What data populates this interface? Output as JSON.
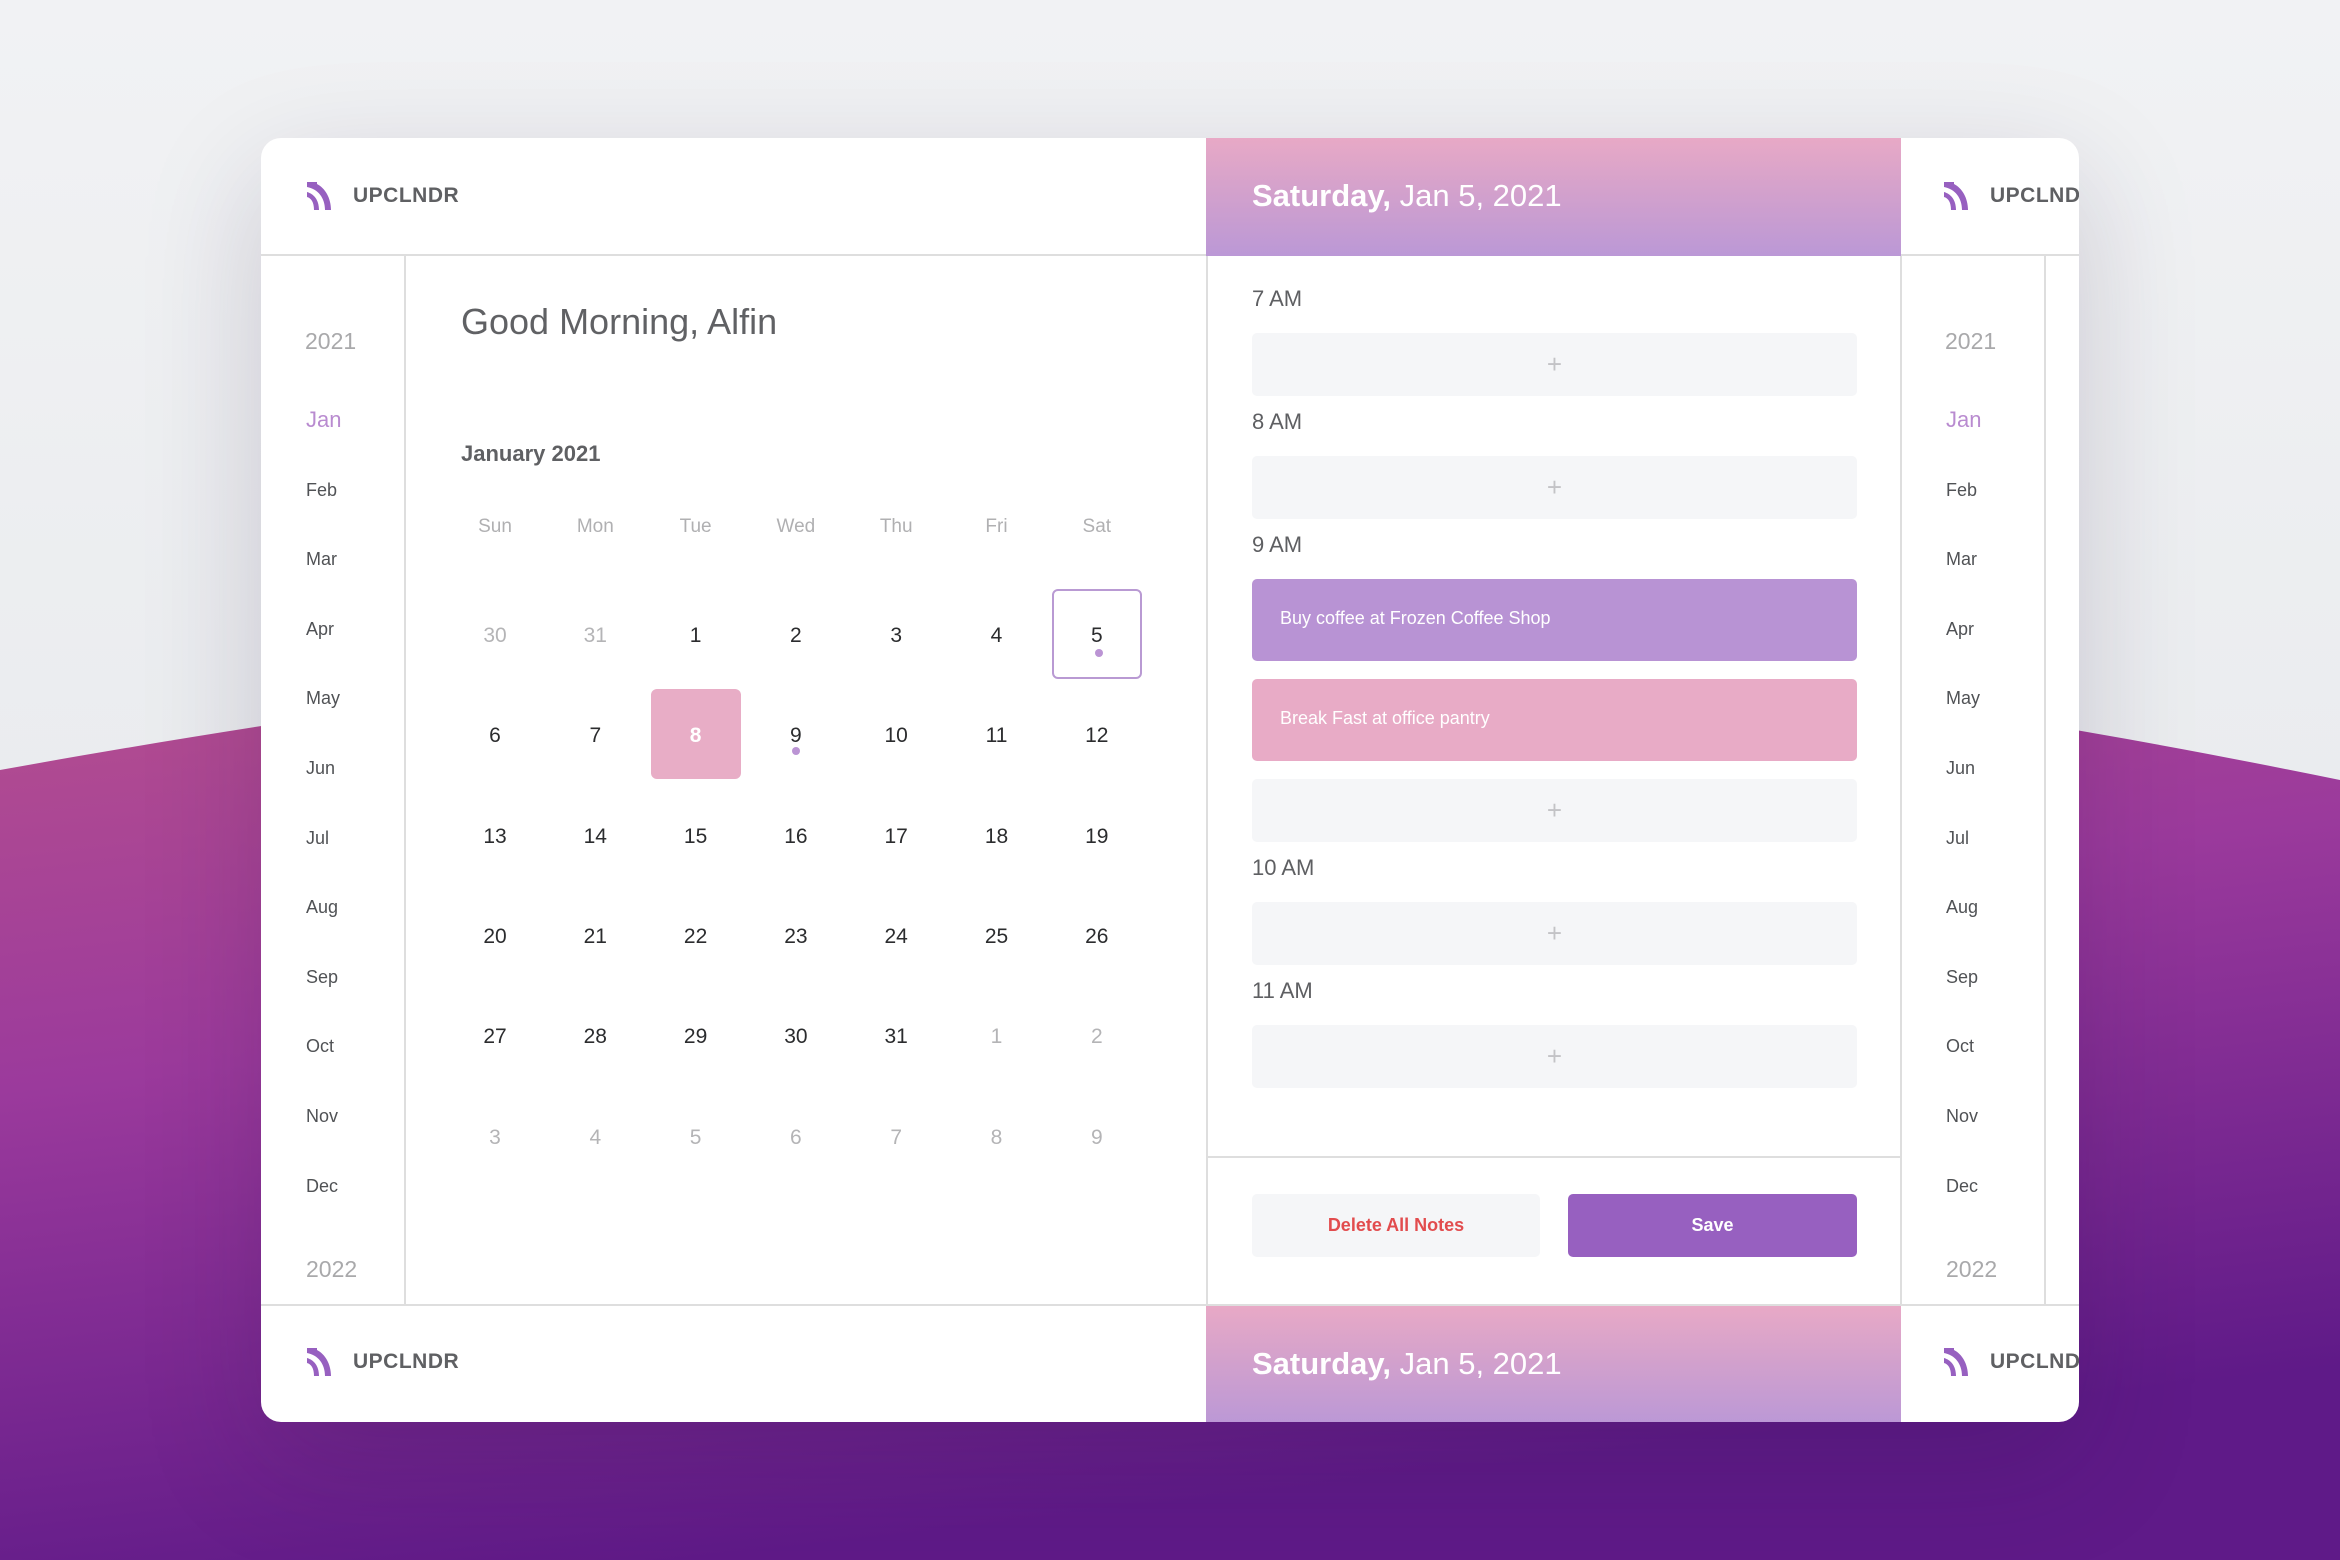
{
  "app": {
    "brand": "UPCLNDR",
    "brand_truncated": "UPCLNDI"
  },
  "header": {
    "weekday": "Saturday,",
    "date": "Jan 5, 2021"
  },
  "sidebar": {
    "year_current": "2021",
    "year_next": "2022",
    "active_month": "Jan",
    "months": [
      "Jan",
      "Feb",
      "Mar",
      "Apr",
      "May",
      "Jun",
      "Jul",
      "Aug",
      "Sep",
      "Oct",
      "Nov",
      "Dec"
    ]
  },
  "main": {
    "greeting": "Good Morning, Alfin",
    "month_title": "January 2021",
    "weekdays": [
      "Sun",
      "Mon",
      "Tue",
      "Wed",
      "Thu",
      "Fri",
      "Sat"
    ],
    "weeks": [
      [
        {
          "d": "30",
          "muted": true
        },
        {
          "d": "31",
          "muted": true
        },
        {
          "d": "1"
        },
        {
          "d": "2"
        },
        {
          "d": "3"
        },
        {
          "d": "4"
        },
        {
          "d": "5",
          "today": true,
          "dot": true
        }
      ],
      [
        {
          "d": "6"
        },
        {
          "d": "7"
        },
        {
          "d": "8",
          "selected": true
        },
        {
          "d": "9",
          "dot": true
        },
        {
          "d": "10"
        },
        {
          "d": "11"
        },
        {
          "d": "12"
        }
      ],
      [
        {
          "d": "13"
        },
        {
          "d": "14"
        },
        {
          "d": "15"
        },
        {
          "d": "16"
        },
        {
          "d": "17"
        },
        {
          "d": "18"
        },
        {
          "d": "19"
        }
      ],
      [
        {
          "d": "20"
        },
        {
          "d": "21"
        },
        {
          "d": "22"
        },
        {
          "d": "23"
        },
        {
          "d": "24"
        },
        {
          "d": "25"
        },
        {
          "d": "26"
        }
      ],
      [
        {
          "d": "27"
        },
        {
          "d": "28"
        },
        {
          "d": "29"
        },
        {
          "d": "30"
        },
        {
          "d": "31"
        },
        {
          "d": "1",
          "muted": true
        },
        {
          "d": "2",
          "muted": true
        }
      ],
      [
        {
          "d": "3",
          "muted": true
        },
        {
          "d": "4",
          "muted": true
        },
        {
          "d": "5",
          "muted": true
        },
        {
          "d": "6",
          "muted": true
        },
        {
          "d": "7",
          "muted": true
        },
        {
          "d": "8",
          "muted": true
        },
        {
          "d": "9",
          "muted": true
        }
      ]
    ]
  },
  "schedule": {
    "add_icon": "+",
    "hours": [
      {
        "label": "7 AM",
        "events": []
      },
      {
        "label": "8 AM",
        "events": []
      },
      {
        "label": "9 AM",
        "events": [
          {
            "title": "Buy coffee at Frozen Coffee Shop",
            "color": "#b893d4"
          },
          {
            "title": "Break Fast at office pantry",
            "color": "#e8abc6"
          }
        ]
      },
      {
        "label": "10 AM",
        "events": []
      },
      {
        "label": "11 AM",
        "events": []
      }
    ]
  },
  "actions": {
    "delete_label": "Delete All Notes",
    "save_label": "Save"
  },
  "colors": {
    "accent": "#9760c0",
    "danger": "#e24c4e",
    "event_purple": "#b893d4",
    "event_pink": "#e8abc6"
  }
}
